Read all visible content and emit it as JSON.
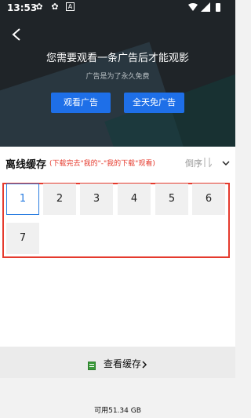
{
  "status_bar": {
    "time": "13:53"
  },
  "ad": {
    "message": "您需要观看一条广告后才能观影",
    "sub_message": "广告是为了永久免费",
    "watch_ad_label": "观看广告",
    "all_day_free_label": "全天免广告"
  },
  "offline": {
    "title": "离线缓存",
    "hint": "(下载完去\"我的\"-\"我的下载\"观看)",
    "order_label": "倒序",
    "episodes": [
      {
        "label": "1",
        "active": true
      },
      {
        "label": "2",
        "active": false
      },
      {
        "label": "3",
        "active": false
      },
      {
        "label": "4",
        "active": false
      },
      {
        "label": "5",
        "active": false
      },
      {
        "label": "6",
        "active": false
      },
      {
        "label": "7",
        "active": false
      }
    ]
  },
  "footer": {
    "view_cache_label": "查看缓存",
    "storage_text": "可用51.34 GB"
  },
  "colors": {
    "accent": "#1e6fe8",
    "hint_red": "#e53a2d",
    "highlight_box": "#e53a2d"
  }
}
